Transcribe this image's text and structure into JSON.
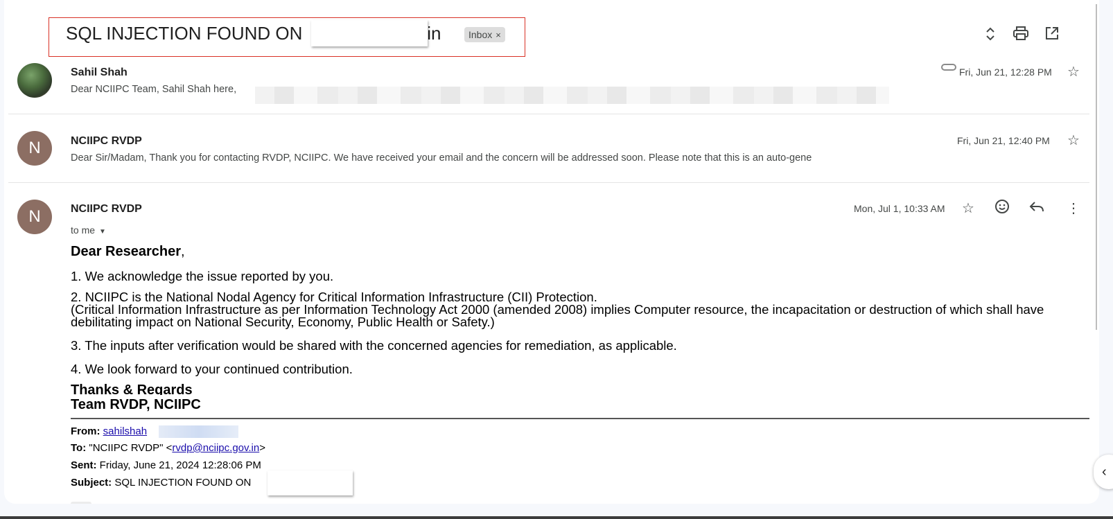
{
  "thread": {
    "subject": "SQL INJECTION FOUND ON",
    "subject_suffix": "s.in",
    "label_chip": "Inbox",
    "label_chip_close": "×",
    "icons": [
      "expand-collapse-icon",
      "print-icon",
      "open-in-new-window-icon"
    ]
  },
  "messages": [
    {
      "sender": "Sahil Shah",
      "snippet": "Dear NCIIPC Team, Sahil Shah here,",
      "time": "Fri, Jun 21, 12:28 PM",
      "has_attachment": true
    },
    {
      "avatar_letter": "N",
      "sender": "NCIIPC RVDP",
      "snippet": "Dear Sir/Madam, Thank you for contacting RVDP, NCIIPC. We have received your email and the concern will be addressed soon. Please note that this is an auto-gene",
      "time": "Fri, Jun 21, 12:40 PM"
    }
  ],
  "open_message": {
    "avatar_letter": "N",
    "sender": "NCIIPC RVDP",
    "recipient": "to me",
    "time": "Mon, Jul 1, 10:33 AM",
    "greeting_bold": "Dear Researcher",
    "greeting_comma": ",",
    "p1": "1. We acknowledge the issue reported by you.",
    "p2": "2. NCIIPC is the National Nodal Agency for Critical Information Infrastructure (CII) Protection.",
    "p2b": "(Critical Information Infrastructure as per Information Technology Act 2000 (amended 2008) implies Computer resource, the incapacitation or destruction of which shall have debilitating impact on National Security, Economy, Public Health or Safety.)",
    "p3": "3. The inputs after verification would be shared with the concerned agencies for remediation, as applicable.",
    "p4": "4. We look forward to your continued contribution.",
    "signoff": "Thanks & Regards",
    "team": "Team RVDP, NCIIPC",
    "quoted": {
      "from_label": "From:",
      "from_value": "sahilshah",
      "from_value_tail": "n",
      "to_label": "To:",
      "to_value_prefix": "\"NCIIPC RVDP\" <",
      "to_email": "rvdp@nciipc.gov.in",
      "to_value_suffix": ">",
      "sent_label": "Sent:",
      "sent_value": "Friday, June 21, 2024 12:28:06 PM",
      "subject_label": "Subject:",
      "subject_value": "SQL INJECTION FOUND ON"
    }
  }
}
